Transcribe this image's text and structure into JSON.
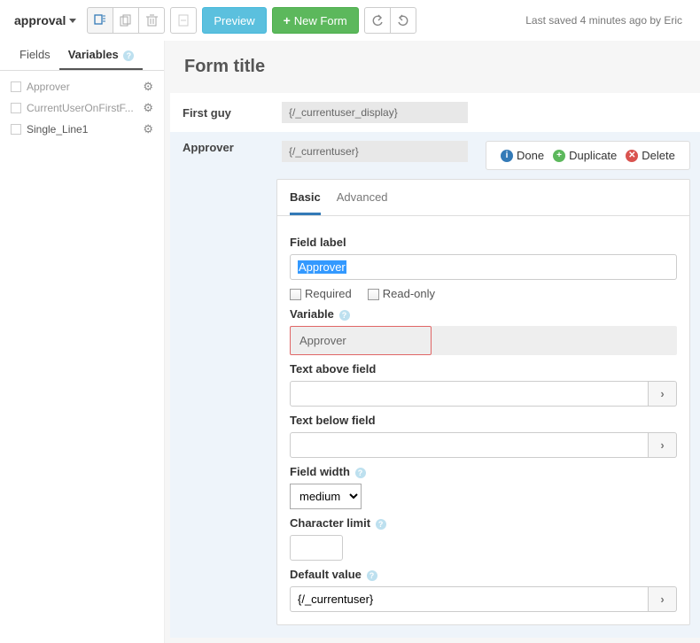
{
  "header": {
    "dropdown_label": "approval",
    "preview_label": "Preview",
    "newform_label": "New Form",
    "saved_text": "Last saved 4 minutes ago by Eric"
  },
  "leftTabs": {
    "fields": "Fields",
    "variables": "Variables"
  },
  "sidebar": {
    "items": [
      {
        "name": "Approver"
      },
      {
        "name": "CurrentUserOnFirstF..."
      },
      {
        "name": "Single_Line1"
      }
    ]
  },
  "form": {
    "title": "Form title",
    "rows": [
      {
        "label": "First guy",
        "value": "{/_currentuser_display}"
      },
      {
        "label": "Approver",
        "value": "{/_currentuser}"
      }
    ]
  },
  "actions": {
    "done": "Done",
    "duplicate": "Duplicate",
    "delete": "Delete"
  },
  "settings": {
    "tabs": {
      "basic": "Basic",
      "advanced": "Advanced"
    },
    "field_label_lbl": "Field label",
    "field_label_val": "Approver",
    "required_lbl": "Required",
    "readonly_lbl": "Read-only",
    "variable_lbl": "Variable",
    "variable_val": "Approver",
    "text_above_lbl": "Text above field",
    "text_above_val": "",
    "text_below_lbl": "Text below field",
    "text_below_val": "",
    "field_width_lbl": "Field width",
    "field_width_val": "medium",
    "char_limit_lbl": "Character limit",
    "char_limit_val": "",
    "default_lbl": "Default value",
    "default_val": "{/_currentuser}"
  }
}
